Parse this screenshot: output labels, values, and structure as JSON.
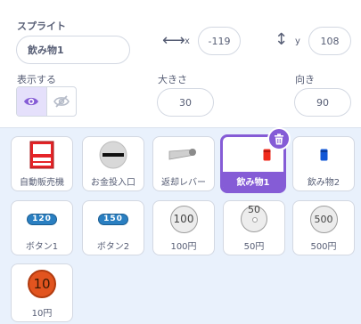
{
  "sprite": {
    "label": "スプライト",
    "name": "飲み物1"
  },
  "position": {
    "x_label": "x",
    "x_value": "-119",
    "y_label": "y",
    "y_value": "108"
  },
  "show": {
    "label": "表示する"
  },
  "size": {
    "label": "大きさ",
    "value": "30"
  },
  "direction": {
    "label": "向き",
    "value": "90"
  },
  "colors": {
    "accent": "#855cd6",
    "text": "#575e75",
    "panel_bg": "#e9f1fc",
    "border": "#d3d8e2"
  },
  "sprites": [
    {
      "name": "自動販売機",
      "icon": "vending-machine-icon"
    },
    {
      "name": "お金投入口",
      "icon": "coin-slot-icon"
    },
    {
      "name": "返却レバー",
      "icon": "return-lever-icon"
    },
    {
      "name": "飲み物1",
      "icon": "red-drink-icon",
      "selected": true
    },
    {
      "name": "飲み物2",
      "icon": "blue-drink-icon"
    },
    {
      "name": "ボタン1",
      "icon": "button-120-icon",
      "badge": "120"
    },
    {
      "name": "ボタン2",
      "icon": "button-150-icon",
      "badge": "150"
    },
    {
      "name": "100円",
      "icon": "coin-100-icon",
      "coin": "100"
    },
    {
      "name": "50円",
      "icon": "coin-50-icon",
      "coin": "50"
    },
    {
      "name": "500円",
      "icon": "coin-500-icon",
      "coin": "500"
    },
    {
      "name": "10円",
      "icon": "coin-10-icon",
      "coin": "10"
    }
  ]
}
